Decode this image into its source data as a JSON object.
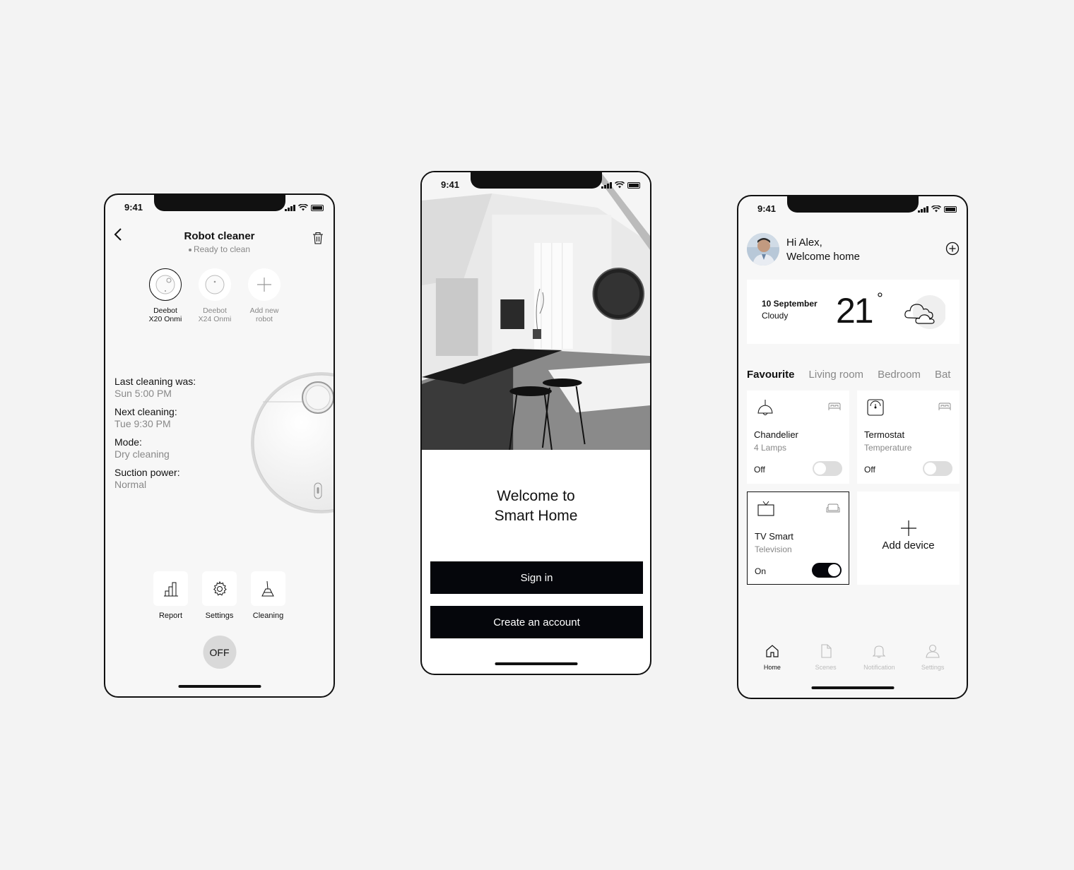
{
  "status": {
    "time": "9:41"
  },
  "robot_screen": {
    "title": "Robot cleaner",
    "subtitle": "Ready to clean",
    "robots": [
      {
        "label_line1": "Deebot",
        "label_line2": "X20 Onmi",
        "selected": true
      },
      {
        "label_line1": "Deebot",
        "label_line2": "X24 Onmi",
        "selected": false
      },
      {
        "label_line1": "Add new",
        "label_line2": "robot",
        "selected": false
      }
    ],
    "info": [
      {
        "key": "Last cleaning was:",
        "value": "Sun 5:00 PM"
      },
      {
        "key": "Next cleaning:",
        "value": "Tue 9:30 PM"
      },
      {
        "key": "Mode:",
        "value": "Dry cleaning"
      },
      {
        "key": "Suction power:",
        "value": "Normal"
      }
    ],
    "actions": [
      {
        "label": "Report",
        "icon": "chart-icon"
      },
      {
        "label": "Settings",
        "icon": "gear-icon"
      },
      {
        "label": "Cleaning",
        "icon": "broom-icon"
      }
    ],
    "power_label": "OFF"
  },
  "welcome_screen": {
    "title_line1": "Welcome to",
    "title_line2": "Smart Home",
    "signin_label": "Sign in",
    "create_label": "Create an account"
  },
  "home_screen": {
    "greeting_line1": "Hi Alex,",
    "greeting_line2": "Welcome home",
    "weather": {
      "date": "10 September",
      "condition": "Cloudy",
      "temperature": "21",
      "degree": "°"
    },
    "tabs": [
      "Favourite",
      "Living room",
      "Bedroom",
      "Bat"
    ],
    "devices": [
      {
        "name": "Chandelier",
        "sub": "4 Lamps",
        "state": "Off",
        "on": false,
        "icon": "lamp-icon",
        "room_icon": "bed-icon"
      },
      {
        "name": "Termostat",
        "sub": "Temperature",
        "state": "Off",
        "on": false,
        "icon": "thermostat-icon",
        "room_icon": "bed-icon"
      },
      {
        "name": "TV Smart",
        "sub": "Television",
        "state": "On",
        "on": true,
        "icon": "tv-icon",
        "room_icon": "sofa-icon"
      }
    ],
    "add_device_label": "Add device",
    "nav": [
      {
        "label": "Home",
        "icon": "home-icon",
        "active": true
      },
      {
        "label": "Scenes",
        "icon": "document-icon",
        "active": false
      },
      {
        "label": "Notification",
        "icon": "bell-icon",
        "active": false
      },
      {
        "label": "Settings",
        "icon": "user-icon",
        "active": false
      }
    ]
  }
}
